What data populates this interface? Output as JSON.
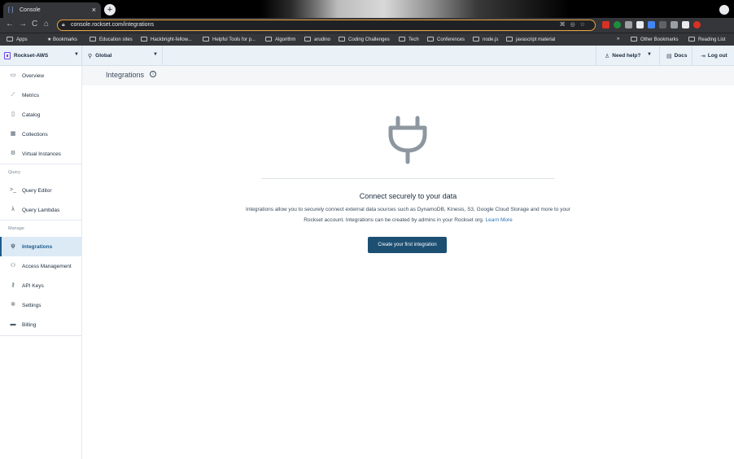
{
  "browser": {
    "tab_title": "Console",
    "tab_close": "×",
    "new_tab": "+",
    "url": "console.rockset.com/integrations",
    "bookmarks": [
      "Apps",
      "Bookmarks",
      "Education sites",
      "Hackbright-fellow...",
      "Helpful Tools for p...",
      "Algorithm",
      "arudino",
      "Coding Challenges",
      "Tech",
      "Conferences",
      "node.js",
      "javascript material"
    ],
    "other_bookmarks": "Other Bookmarks",
    "reading_list": "Reading List",
    "overflow": "»"
  },
  "topbar": {
    "org_name": "Rockset-AWS",
    "region": "Global",
    "help": "Need help?",
    "docs": "Docs",
    "logout": "Log out"
  },
  "sidebar": {
    "items": [
      {
        "label": "Overview",
        "icon": "monitor-icon"
      },
      {
        "label": "Metrics",
        "icon": "chart-icon"
      },
      {
        "label": "Catalog",
        "icon": "book-icon"
      },
      {
        "label": "Collections",
        "icon": "table-icon"
      },
      {
        "label": "Virtual Instances",
        "icon": "gear-icon"
      }
    ],
    "query_section": "Query",
    "query_items": [
      {
        "label": "Query Editor",
        "icon": "terminal-icon"
      },
      {
        "label": "Query Lambdas",
        "icon": "lambda-icon"
      }
    ],
    "manage_section": "Manage",
    "manage_items": [
      {
        "label": "Integrations",
        "icon": "plug-icon"
      },
      {
        "label": "Access Management",
        "icon": "users-icon"
      },
      {
        "label": "API Keys",
        "icon": "key-icon"
      },
      {
        "label": "Settings",
        "icon": "settings-icon"
      },
      {
        "label": "Billing",
        "icon": "card-icon"
      }
    ]
  },
  "page": {
    "title": "Integrations",
    "headline": "Connect securely to your data",
    "description": "Integrations allow you to securely connect external data sources such as DynamoDB, Kinesis, S3, Google Cloud Storage and more to your Rockset account. Integrations can be created by admins in your Rockset org.",
    "learn_more": "Learn More",
    "cta": "Create your first integration"
  },
  "colors": {
    "accent": "#1d4f73",
    "active_bg": "#dceaf6",
    "link": "#2a73b8"
  }
}
